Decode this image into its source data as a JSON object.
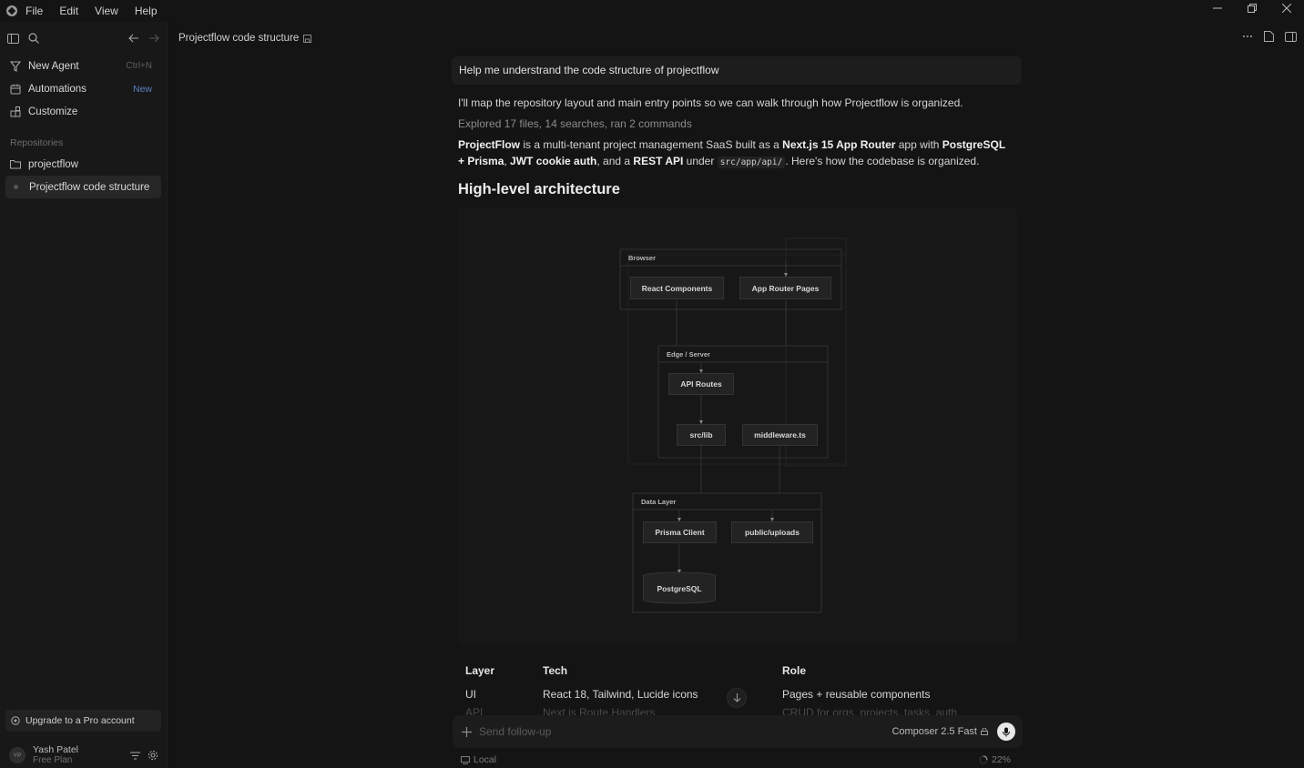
{
  "menu": [
    "File",
    "Edit",
    "View",
    "Help"
  ],
  "sidebar": {
    "items": [
      {
        "label": "New Agent",
        "shortcut": "Ctrl+N",
        "icon": "agent-icon"
      },
      {
        "label": "Automations",
        "badge": "New",
        "icon": "calendar-icon"
      },
      {
        "label": "Customize",
        "icon": "widgets-icon"
      }
    ],
    "section_label": "Repositories",
    "repos": [
      {
        "label": "projectflow",
        "icon": "folder-icon"
      },
      {
        "label": "Projectflow code structure",
        "active": true
      }
    ],
    "upgrade_label": "Upgrade to a Pro account",
    "user": {
      "initials": "YP",
      "name": "Yash Patel",
      "plan": "Free Plan"
    }
  },
  "header": {
    "tab_title": "Projectflow code structure"
  },
  "chat": {
    "prompt": "Help me understrand the code structure of projectflow",
    "intro": "I'll map the repository layout and main entry points so we can walk through how Projectflow is organized.",
    "explored_prefix": "Explored",
    "explored_detail": "17 files, 14 searches, ran 2 commands",
    "summary": {
      "p1": "ProjectFlow",
      "p2": " is a multi-tenant project management SaaS built as a ",
      "p3": "Next.js 15 App Router",
      "p4": " app with ",
      "p5": "PostgreSQL + Prisma",
      "p6": ", ",
      "p7": "JWT cookie auth",
      "p8": ", and a ",
      "p9": "REST API",
      "p10": " under ",
      "code": "src/app/api/",
      "p11": ". Here's how the codebase is organized."
    },
    "heading": "High-level architecture"
  },
  "diagram": {
    "groups": {
      "browser": "Browser",
      "edge": "Edge / Server",
      "data": "Data Layer"
    },
    "nodes": {
      "react": "React Components",
      "pages": "App Router Pages",
      "api": "API Routes",
      "srclib": "src/lib",
      "middleware": "middleware.ts",
      "prisma": "Prisma Client",
      "uploads": "public/uploads",
      "postgres": "PostgreSQL"
    }
  },
  "table": {
    "headers": [
      "Layer",
      "Tech",
      "Role"
    ],
    "rows": [
      [
        "UI",
        "React 18, Tailwind, Lucide icons",
        "Pages + reusable components"
      ],
      [
        "API",
        "Next.js Route Handlers",
        "CRUD for orgs, projects, tasks, auth"
      ]
    ]
  },
  "composer": {
    "placeholder": "Send follow-up",
    "model": "Composer 2.5 Fast"
  },
  "footer": {
    "env": "Local",
    "progress": "22%"
  }
}
